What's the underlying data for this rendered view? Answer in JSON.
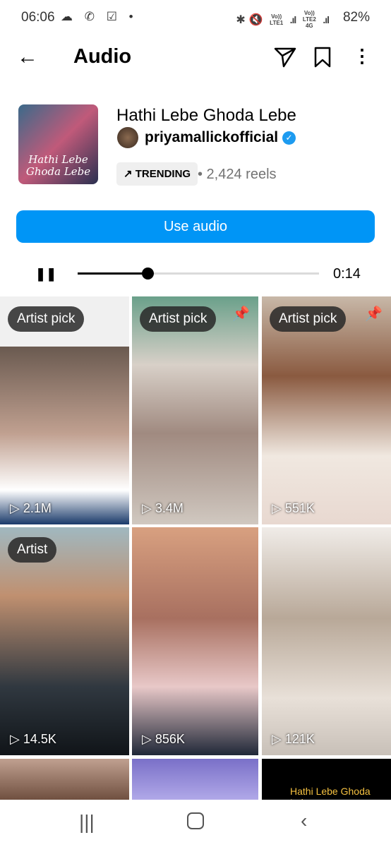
{
  "status": {
    "time": "06:06",
    "battery": "82%",
    "left_icons": [
      "cloud-icon",
      "missed-call-icon",
      "check-icon",
      "dot-icon"
    ],
    "right_icons": [
      "bluetooth-icon",
      "mute-icon",
      "Vo)) LTE1",
      "signal-icon",
      "Vo)) LTE2 4G",
      "signal-icon"
    ]
  },
  "header": {
    "title": "Audio"
  },
  "audio": {
    "cover_text": "Hathi Lebe Ghoda Lebe",
    "song": "Hathi Lebe Ghoda Lebe",
    "artist": "priyamallickofficial",
    "trending": "TRENDING",
    "reels": "• 2,424 reels",
    "use_label": "Use audio",
    "time": "0:14",
    "progress": 0.29
  },
  "tiles": [
    {
      "badge": "Artist pick",
      "views": "2.1M",
      "pinned": false,
      "bg": "linear-gradient(180deg,#f0f0f0 0 22%,#6a5a50 22%,#c0a090 60%,#fff 85%,#1a3a6a)"
    },
    {
      "badge": "Artist pick",
      "views": "3.4M",
      "pinned": true,
      "bg": "linear-gradient(180deg,#6aa08a,#d8d0c8 30%,#a08a80 60%,#d0c8c0)"
    },
    {
      "badge": "Artist pick",
      "views": "551K",
      "pinned": true,
      "bg": "linear-gradient(180deg,#c8b8a8,#8a5a40 35%,#f0e8e0 70%,#e8d8d0)"
    },
    {
      "badge": "Artist",
      "views": "14.5K",
      "pinned": false,
      "bg": "linear-gradient(180deg,#a0b8c0,#c09070 30%,#303840 70%,#101418)"
    },
    {
      "badge": "",
      "views": "856K",
      "pinned": false,
      "bg": "linear-gradient(180deg,#d8a080,#a87060 40%,#e8c8c8 70%,#202838)"
    },
    {
      "badge": "",
      "views": "121K",
      "pinned": false,
      "bg": "linear-gradient(180deg,#f0ece8,#b8a898 40%,#e8e0d8 75%,#c8c0b8)"
    },
    {
      "badge": "",
      "views": "",
      "pinned": false,
      "bg": "linear-gradient(180deg,#c0a090,#705040)"
    },
    {
      "badge": "",
      "views": "",
      "pinned": false,
      "bg": "linear-gradient(180deg,#7a70c8,#b0a8e8)"
    },
    {
      "badge": "Hathi Lebe Ghoda Lebe",
      "views": "",
      "pinned": false,
      "bg": "#000"
    }
  ]
}
